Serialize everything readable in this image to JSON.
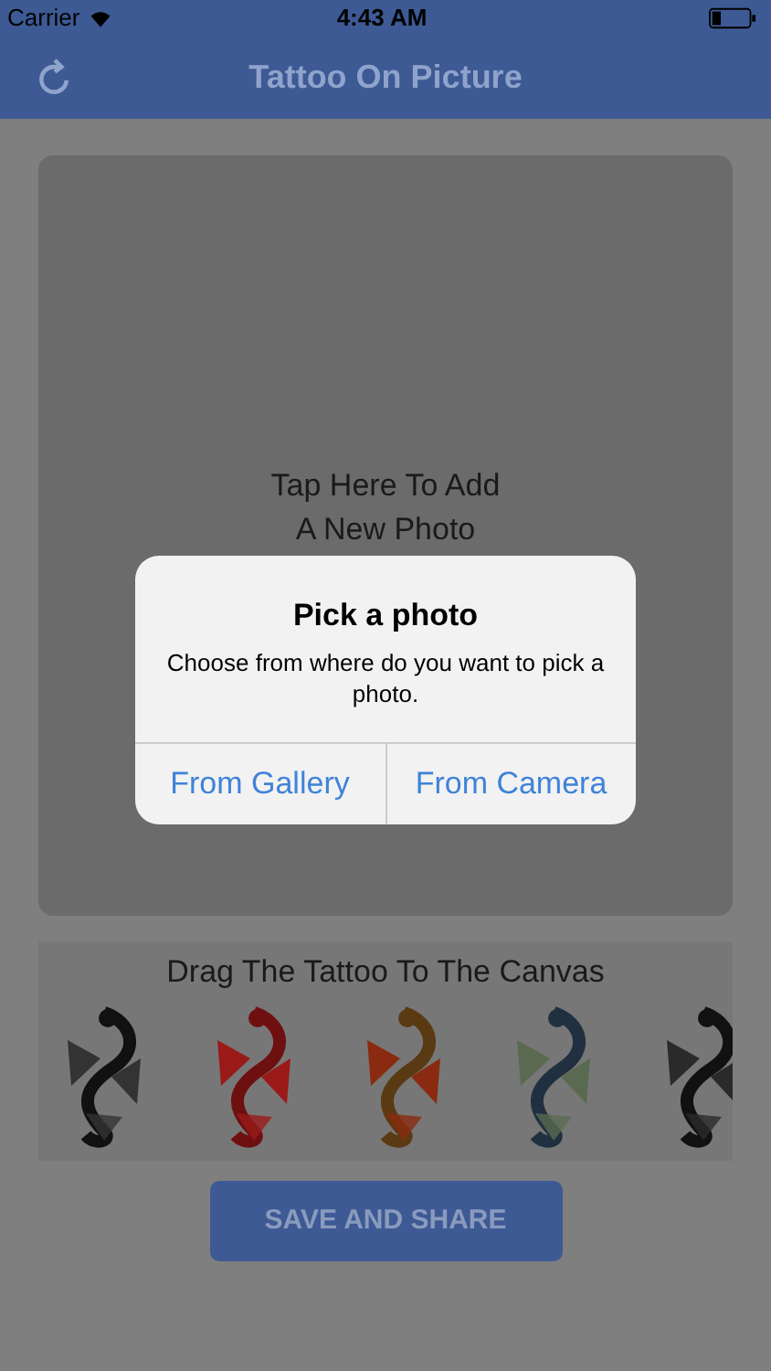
{
  "status_bar": {
    "carrier": "Carrier",
    "time": "4:43 AM"
  },
  "nav_bar": {
    "title": "Tattoo On Picture"
  },
  "canvas": {
    "prompt_lines": [
      "Tap Here To Add",
      "A New Photo"
    ]
  },
  "tattoo_strip": {
    "caption": "Drag The Tattoo To The Canvas"
  },
  "save_button": {
    "label": "SAVE AND SHARE"
  },
  "alert": {
    "title": "Pick a photo",
    "message": "Choose from where do you want to pick a photo.",
    "buttons": [
      "From Gallery",
      "From Camera"
    ]
  }
}
